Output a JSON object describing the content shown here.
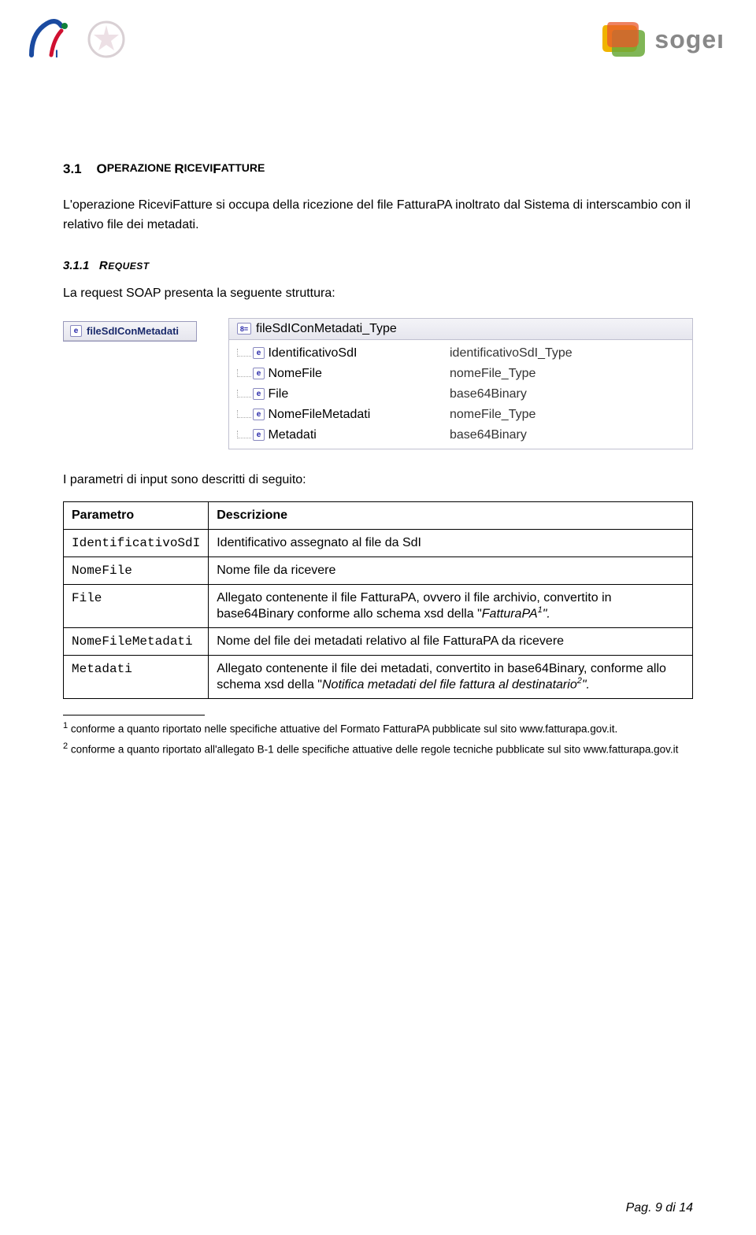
{
  "header": {
    "logo_left_alt": "SdI",
    "logo_right_text": "sogeı"
  },
  "section": {
    "number": "3.1",
    "title_main": "O",
    "title_rest_small": "PERAZIONE ",
    "title_main2": "R",
    "title_rest_small2": "ICEVI",
    "title_main3": "F",
    "title_rest_small3": "ATTURE"
  },
  "intro_text": "L'operazione RiceviFatture si occupa della ricezione del file FatturaPA inoltrato dal Sistema di interscambio con il relativo file dei metadati.",
  "subsection": {
    "number": "3.1.1",
    "title": "REQUEST"
  },
  "request_text": "La request SOAP presenta la seguente struttura:",
  "schema_left": {
    "root": "fileSdIConMetadati"
  },
  "schema_right": {
    "header_name": "fileSdIConMetadati_Type",
    "rows": [
      {
        "name": "IdentificativoSdI",
        "type": "identificativoSdI_Type"
      },
      {
        "name": "NomeFile",
        "type": "nomeFile_Type"
      },
      {
        "name": "File",
        "type": "base64Binary"
      },
      {
        "name": "NomeFileMetadati",
        "type": "nomeFile_Type"
      },
      {
        "name": "Metadati",
        "type": "base64Binary"
      }
    ]
  },
  "desc_intro": "I parametri di input sono descritti di seguito:",
  "table": {
    "head": {
      "param": "Parametro",
      "desc": "Descrizione"
    },
    "rows": [
      {
        "param": "IdentificativoSdI",
        "desc": "Identificativo assegnato al file da SdI"
      },
      {
        "param": "NomeFile",
        "desc": "Nome file da ricevere"
      },
      {
        "param": "File",
        "desc_pre": "Allegato contenente il file FatturaPA, ovvero il file archivio, convertito in base64Binary conforme allo schema xsd della \"",
        "desc_ital": "FatturaPA",
        "desc_sup": "1",
        "desc_post": "\"."
      },
      {
        "param": "NomeFileMetadati",
        "desc": "Nome del file dei metadati relativo al file FatturaPA da ricevere"
      },
      {
        "param": "Metadati",
        "desc_pre": "Allegato contenente il file dei metadati, convertito in base64Binary, conforme allo schema xsd della \"",
        "desc_ital": "Notifica metadati del file fattura al destinatario",
        "desc_sup": "2",
        "desc_post": "\"."
      }
    ]
  },
  "footnotes": [
    {
      "num": "1",
      "text": " conforme a quanto riportato nelle specifiche attuative del Formato FatturaPA pubblicate sul sito www.fatturapa.gov.it."
    },
    {
      "num": "2",
      "text": " conforme a quanto riportato all'allegato B-1 delle specifiche attuative delle regole tecniche pubblicate sul sito www.fatturapa.gov.it"
    }
  ],
  "page_number": "Pag. 9 di 14"
}
